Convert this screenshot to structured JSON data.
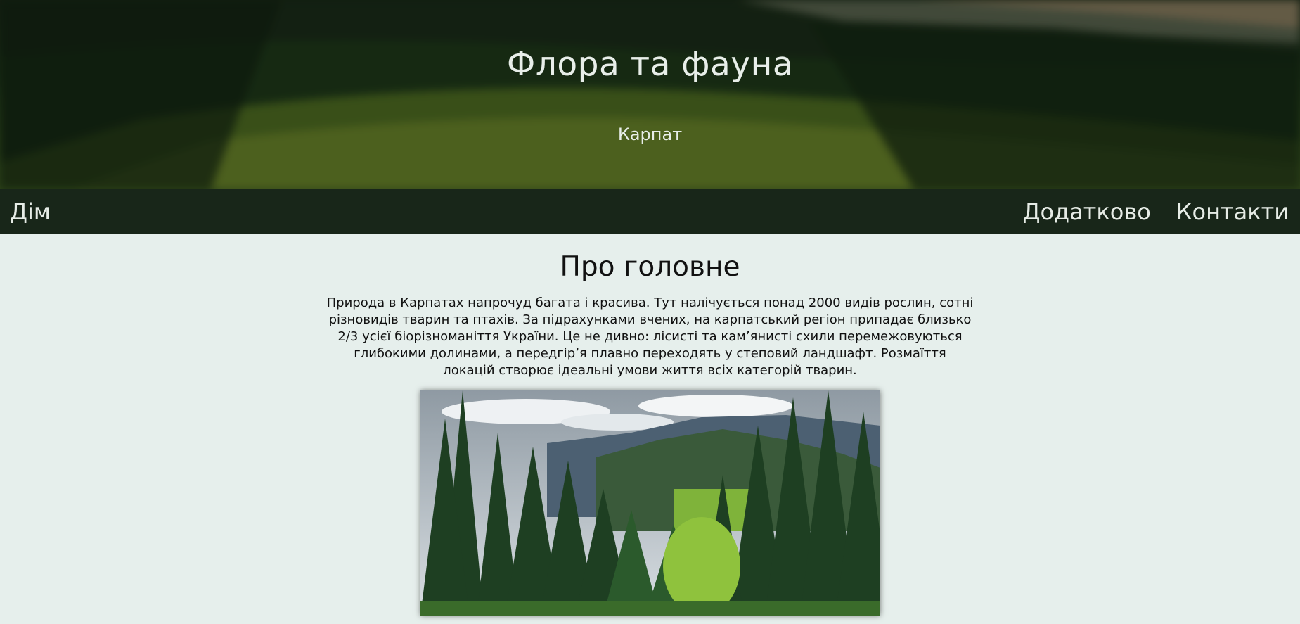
{
  "hero": {
    "title": "Флора та фауна",
    "subtitle": "Карпат"
  },
  "nav": {
    "home": "Дім",
    "more": "Додатково",
    "contacts": "Контакти"
  },
  "main": {
    "heading": "Про головне",
    "paragraph": "Природа в Карпатах напрочуд багата і красива. Тут налічується понад 2000 видів рослин, сотні різновидів тварин та птахів. За підрахунками вчених, на карпатський регіон припадає близько 2/3 усієї біорізноманіття України. Це не дивно: лісисті та кам’янисті схили перемежовуються глибокими долинами, а передгір’я плавно переходять у степовий ландшафт. Розмаїття локацій створює ідеальні умови життя всіх категорій тварин."
  },
  "colors": {
    "nav_bg": "#182619",
    "page_bg": "#e6efec",
    "text_light": "#e8eee9"
  }
}
